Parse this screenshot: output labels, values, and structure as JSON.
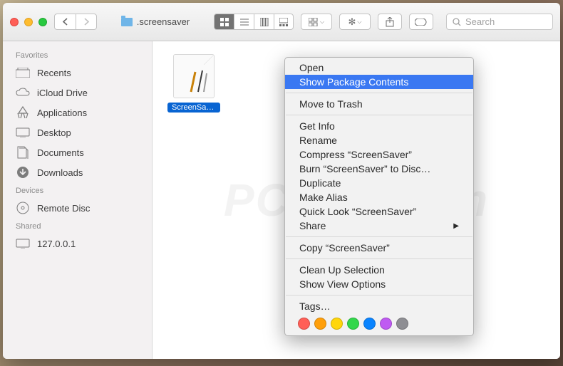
{
  "window": {
    "title": ".screensaver"
  },
  "search": {
    "placeholder": "Search"
  },
  "sidebar": {
    "sections": [
      {
        "title": "Favorites",
        "items": [
          {
            "label": "Recents"
          },
          {
            "label": "iCloud Drive"
          },
          {
            "label": "Applications"
          },
          {
            "label": "Desktop"
          },
          {
            "label": "Documents"
          },
          {
            "label": "Downloads"
          }
        ]
      },
      {
        "title": "Devices",
        "items": [
          {
            "label": "Remote Disc"
          }
        ]
      },
      {
        "title": "Shared",
        "items": [
          {
            "label": "127.0.0.1"
          }
        ]
      }
    ]
  },
  "files": [
    {
      "name": "ScreenSaver"
    }
  ],
  "context_menu": {
    "items": [
      {
        "label": "Open"
      },
      {
        "label": "Show Package Contents",
        "highlighted": true
      }
    ],
    "group2": [
      {
        "label": "Move to Trash"
      }
    ],
    "group3": [
      {
        "label": "Get Info"
      },
      {
        "label": "Rename"
      },
      {
        "label": "Compress “ScreenSaver”"
      },
      {
        "label": "Burn “ScreenSaver” to Disc…"
      },
      {
        "label": "Duplicate"
      },
      {
        "label": "Make Alias"
      },
      {
        "label": "Quick Look “ScreenSaver”"
      },
      {
        "label": "Share",
        "submenu": true
      }
    ],
    "group4": [
      {
        "label": "Copy “ScreenSaver”"
      }
    ],
    "group5": [
      {
        "label": "Clean Up Selection"
      },
      {
        "label": "Show View Options"
      }
    ],
    "tags_label": "Tags…",
    "tag_colors": [
      "#ff5f57",
      "#ff9f0a",
      "#ffd60a",
      "#32d74b",
      "#0a84ff",
      "#bf5af2",
      "#8e8e93"
    ]
  },
  "watermark": "PCrisk.com"
}
